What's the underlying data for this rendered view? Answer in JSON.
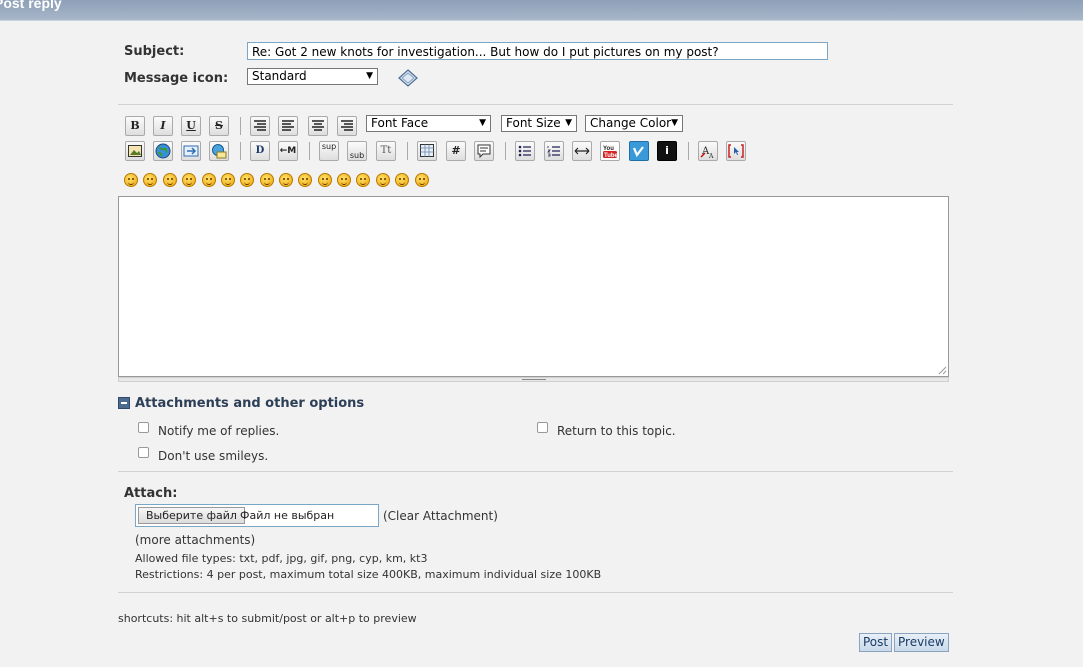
{
  "header": {
    "title": "Post reply"
  },
  "form": {
    "subject_label": "Subject:",
    "subject_value": "Re: Got 2 new knots for investigation...  But how do I put pictures on my post?",
    "message_icon_label": "Message icon:",
    "message_icon_value": "Standard"
  },
  "toolbar": {
    "font_face": "Font Face",
    "font_size": "Font Size",
    "change_color": "Change Color",
    "bold": "B",
    "italic": "I",
    "underline": "U",
    "strike": "S",
    "sup": "sup",
    "sub": "sub",
    "tt": "Tt",
    "hash": "#",
    "move": "←M"
  },
  "attachments_section": {
    "title": "Attachments and other options",
    "notify": "Notify me of replies.",
    "return_topic": "Return to this topic.",
    "no_smileys": "Don't use smileys."
  },
  "attach": {
    "label": "Attach:",
    "choose_file": "Выберите файл",
    "no_file": "Файл не выбран",
    "clear": "(Clear Attachment)",
    "more": "(more attachments)",
    "allowed": "Allowed file types: txt, pdf, jpg, gif, png, cyp, km, kt3",
    "restrictions": "Restrictions: 4 per post, maximum total size 400KB, maximum individual size 100KB"
  },
  "footer": {
    "shortcuts": "shortcuts: hit alt+s to submit/post or alt+p to preview",
    "post": "Post",
    "preview": "Preview"
  }
}
